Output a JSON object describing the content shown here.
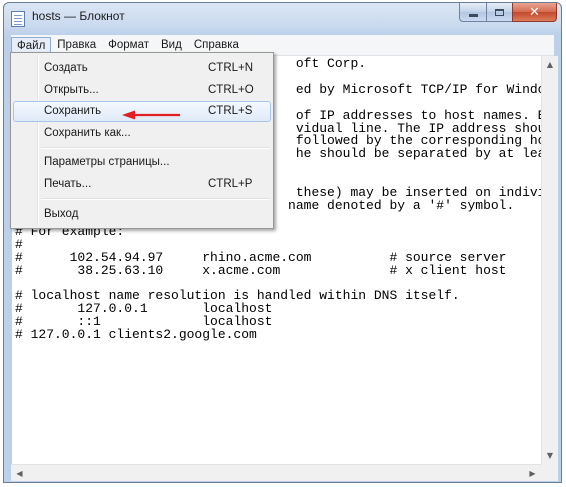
{
  "window": {
    "title": "hosts — Блокнот"
  },
  "menubar": {
    "items": [
      "Файл",
      "Правка",
      "Формат",
      "Вид",
      "Справка"
    ]
  },
  "file_menu": {
    "items": [
      {
        "label": "Создать",
        "shortcut": "CTRL+N"
      },
      {
        "label": "Открыть...",
        "shortcut": "CTRL+O"
      },
      {
        "label": "Сохранить",
        "shortcut": "CTRL+S"
      },
      {
        "label": "Сохранить как...",
        "shortcut": ""
      },
      {
        "label": "Параметры страницы...",
        "shortcut": ""
      },
      {
        "label": "Печать...",
        "shortcut": "CTRL+P"
      },
      {
        "label": "Выход",
        "shortcut": ""
      }
    ],
    "highlighted": "Сохранить"
  },
  "editor": {
    "content": "                                    oft Corp.\n\n                                    ed by Microsoft TCP/IP for Windows\n\n                                    of IP addresses to host names. E\n                                    vidual line. The IP address shoul\n                                    followed by the corresponding host\n                                    he should be separated by at least\n\n\n                                    these) may be inserted on indivi\n                                   name denoted by a '#' symbol.\n#\n# For example:\n#\n#      102.54.94.97     rhino.acme.com          # source server\n#       38.25.63.10     x.acme.com              # x client host\n\n# localhost name resolution is handled within DNS itself.\n#\t127.0.0.1       localhost\n#\t::1             localhost\n# 127.0.0.1 clients2.google.com"
  },
  "colors": {
    "annotation_arrow": "#e31e24",
    "menu_highlight": "#dfeaf8"
  }
}
